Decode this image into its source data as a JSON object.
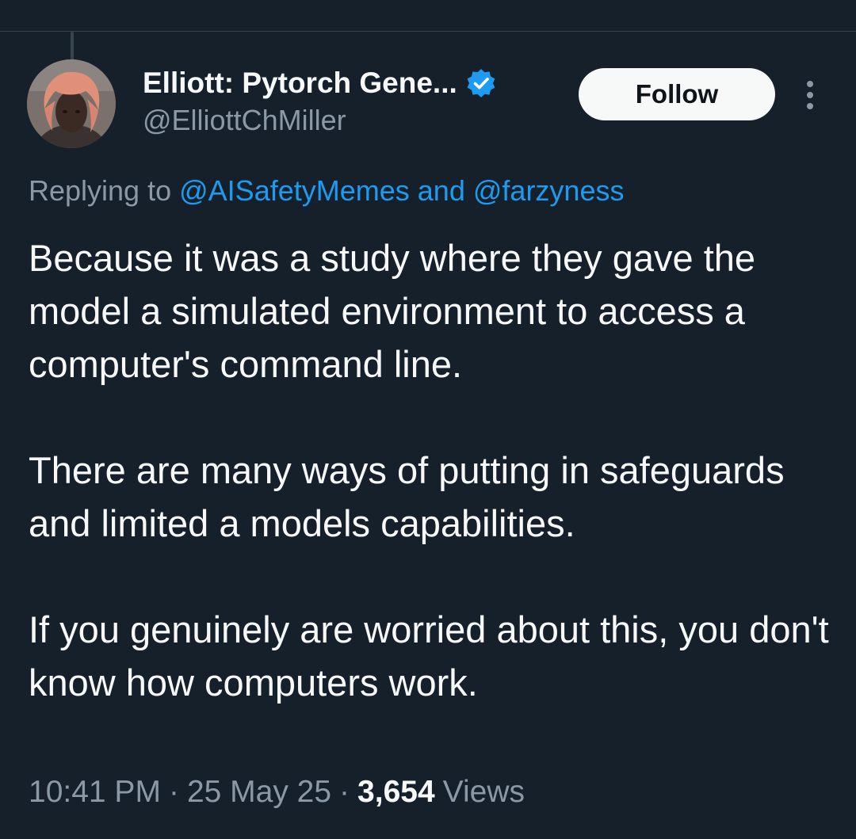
{
  "author": {
    "display_name": "Elliott: Pytorch Gene...",
    "handle": "@ElliottChMiller",
    "verified": true,
    "avatar_icon": "profile-photo"
  },
  "actions": {
    "follow_label": "Follow",
    "more_icon": "more-vertical-icon"
  },
  "reply": {
    "prefix": "Replying to",
    "mention_1": "@AISafetyMemes",
    "conjunction": "and",
    "mention_2": "@farzyness"
  },
  "tweet": {
    "paragraphs": [
      "Because it was a study where they gave the model a simulated environment to access a computer's command line.",
      "There are many ways of putting in safeguards and limited a models capabilities.",
      "If you genuinely are worried about this, you don't know how computers work."
    ]
  },
  "meta": {
    "time": "10:41 PM",
    "separator": "·",
    "date": "25 May 25",
    "views_count": "3,654",
    "views_label": "Views"
  },
  "colors": {
    "background": "#15202b",
    "text_primary": "#f7f9f9",
    "text_secondary": "#8b98a5",
    "link": "#1d9bf0",
    "verified": "#1d9bf0",
    "divider": "#38444d"
  }
}
